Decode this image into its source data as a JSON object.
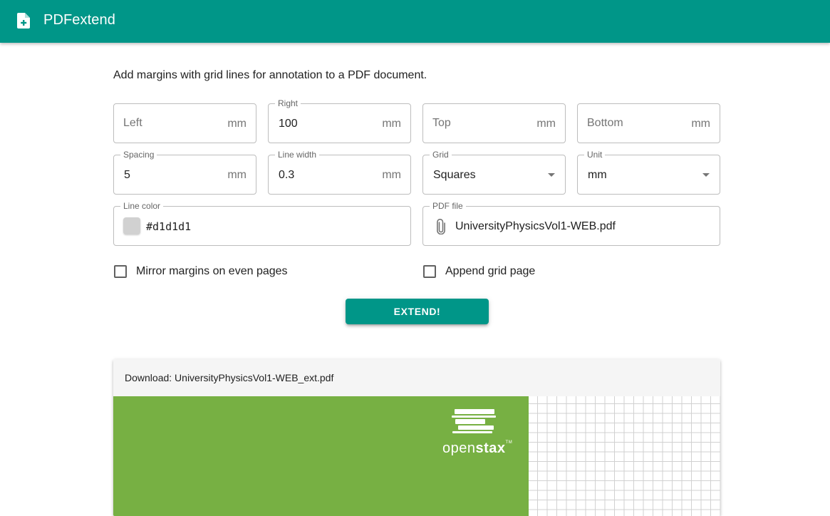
{
  "app": {
    "title": "PDFextend",
    "logo_icon": "file-plus-icon",
    "accent_color": "#009688"
  },
  "intro": "Add margins with grid lines for annotation to a PDF document.",
  "form": {
    "left": {
      "label": "Left",
      "value": "",
      "suffix": "mm"
    },
    "right": {
      "label": "Right",
      "value": "100",
      "suffix": "mm"
    },
    "top": {
      "label": "Top",
      "value": "",
      "suffix": "mm"
    },
    "bottom": {
      "label": "Bottom",
      "value": "",
      "suffix": "mm"
    },
    "spacing": {
      "label": "Spacing",
      "value": "5",
      "suffix": "mm"
    },
    "line_width": {
      "label": "Line width",
      "value": "0.3",
      "suffix": "mm"
    },
    "grid": {
      "label": "Grid",
      "selected": "Squares"
    },
    "unit": {
      "label": "Unit",
      "selected": "mm"
    },
    "line_color": {
      "label": "Line color",
      "value": "#d1d1d1",
      "swatch_color": "#d1d1d1"
    },
    "pdf_file": {
      "label": "PDF file",
      "value": "UniversityPhysicsVol1-WEB.pdf",
      "icon": "paperclip-icon"
    },
    "mirror_margins": {
      "label": "Mirror margins on even pages",
      "checked": false
    },
    "append_grid_page": {
      "label": "Append grid page",
      "checked": false
    },
    "submit_label": "EXTEND!"
  },
  "result": {
    "download_text": "Download: UniversityPhysicsVol1-WEB_ext.pdf",
    "preview": {
      "cover_color": "#77b043",
      "brand_light": "open",
      "brand_bold": "stax",
      "brand_tm": "TM",
      "grid_line_color": "#d1d1d1"
    }
  }
}
